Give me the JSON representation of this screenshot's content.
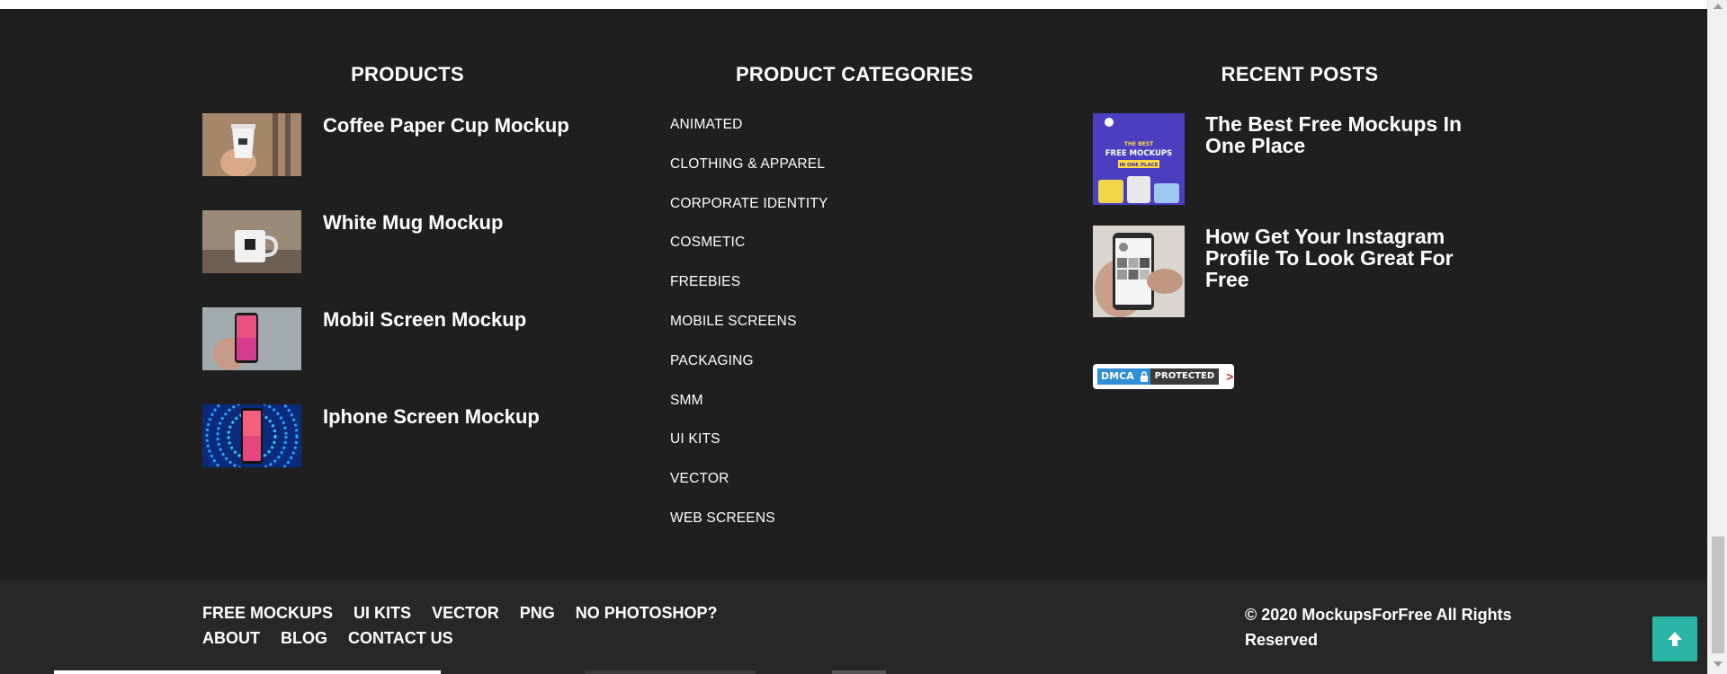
{
  "products": {
    "title": "PRODUCTS",
    "items": [
      {
        "label": "Coffee Paper Cup Mockup",
        "icon": "coffee-cup-thumbnail"
      },
      {
        "label": "White Mug Mockup",
        "icon": "white-mug-thumbnail"
      },
      {
        "label": "Mobil Screen Mockup",
        "icon": "mobile-screen-thumbnail"
      },
      {
        "label": "Iphone Screen Mockup",
        "icon": "iphone-screen-thumbnail"
      }
    ]
  },
  "categories": {
    "title": "PRODUCT CATEGORIES",
    "items": [
      "ANIMATED",
      "CLOTHING & APPAREL",
      "CORPORATE IDENTITY",
      "COSMETIC",
      "FREEBIES",
      "MOBILE SCREENS",
      "PACKAGING",
      "SMM",
      "UI KITS",
      "VECTOR",
      "WEB SCREENS"
    ]
  },
  "posts": {
    "title": "RECENT POSTS",
    "items": [
      {
        "label": "The Best Free Mockups In One Place",
        "thumb_line1": "THE BEST",
        "thumb_line2": "FREE MOCKUPS",
        "thumb_line3": "IN ONE PLACE"
      },
      {
        "label": "How Get Your Instagram Profile To Look Great For Free"
      }
    ]
  },
  "dmca": {
    "left": "DMCA",
    "right": "PROTECTED",
    "arrow": ">"
  },
  "bottom_nav": {
    "row1": [
      "FREE MOCKUPS",
      "UI KITS",
      "VECTOR",
      "PNG",
      "NO PHOTOSHOP?"
    ],
    "row2": [
      "ABOUT",
      "BLOG",
      "CONTACT US"
    ]
  },
  "copyright": "© 2020 MockupsForFree All Rights Reserved",
  "colors": {
    "footer_bg": "#1f1f1f",
    "bottom_bg": "#272727",
    "scroll_top_btn": "#2bb5a7",
    "dmca_blue": "#2f8fd6"
  }
}
